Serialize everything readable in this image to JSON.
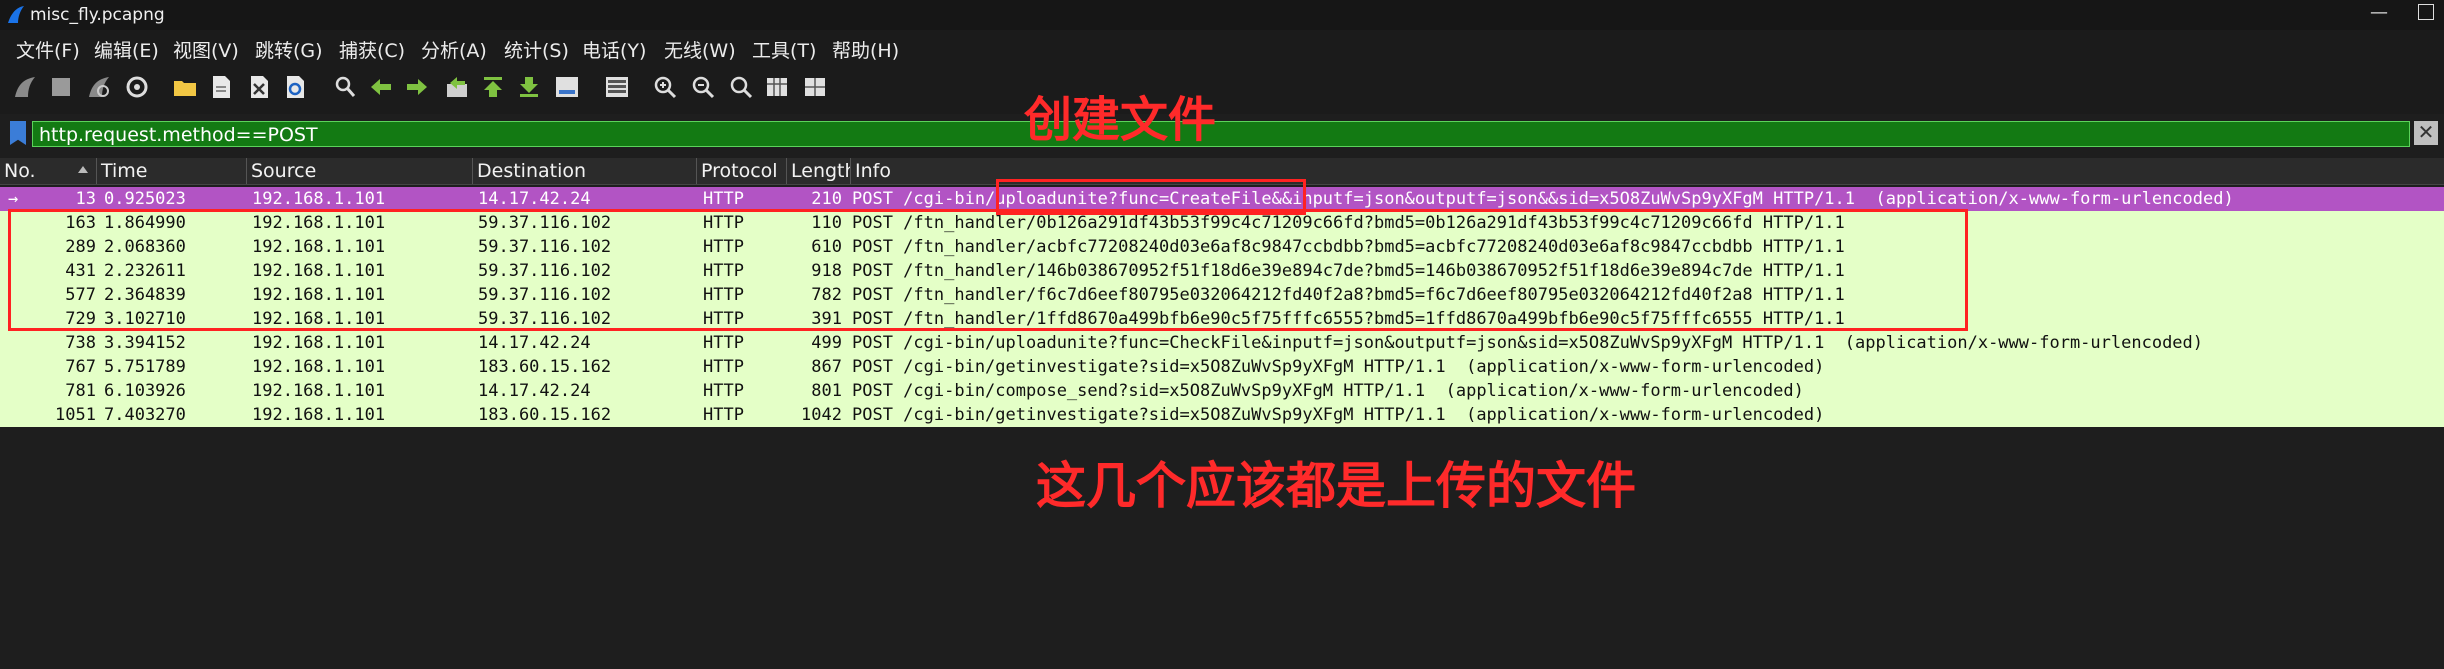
{
  "window": {
    "title": "misc_fly.pcapng",
    "minimize": "—"
  },
  "menu": [
    "文件(F)",
    "编辑(E)",
    "视图(V)",
    "跳转(G)",
    "捕获(C)",
    "分析(A)",
    "统计(S)",
    "电话(Y)",
    "无线(W)",
    "工具(T)",
    "帮助(H)"
  ],
  "filter": {
    "value": "http.request.method==POST",
    "clear": "✕"
  },
  "columns": [
    "No.",
    "Time",
    "Source",
    "Destination",
    "Protocol",
    "Length",
    "Info"
  ],
  "rows": [
    {
      "no": "13",
      "time": "0.925023",
      "src": "192.168.1.101",
      "dst": "14.17.42.24",
      "proto": "HTTP",
      "len": "210",
      "info": "POST /cgi-bin/uploadunite?func=CreateFile&&inputf=json&outputf=json&&sid=x5O8ZuWvSp9yXFgM HTTP/1.1  (application/x-www-form-urlencoded)"
    },
    {
      "no": "163",
      "time": "1.864990",
      "src": "192.168.1.101",
      "dst": "59.37.116.102",
      "proto": "HTTP",
      "len": "110",
      "info": "POST /ftn_handler/0b126a291df43b53f99c4c71209c66fd?bmd5=0b126a291df43b53f99c4c71209c66fd HTTP/1.1"
    },
    {
      "no": "289",
      "time": "2.068360",
      "src": "192.168.1.101",
      "dst": "59.37.116.102",
      "proto": "HTTP",
      "len": "610",
      "info": "POST /ftn_handler/acbfc77208240d03e6af8c9847ccbdbb?bmd5=acbfc77208240d03e6af8c9847ccbdbb HTTP/1.1"
    },
    {
      "no": "431",
      "time": "2.232611",
      "src": "192.168.1.101",
      "dst": "59.37.116.102",
      "proto": "HTTP",
      "len": "918",
      "info": "POST /ftn_handler/146b038670952f51f18d6e39e894c7de?bmd5=146b038670952f51f18d6e39e894c7de HTTP/1.1"
    },
    {
      "no": "577",
      "time": "2.364839",
      "src": "192.168.1.101",
      "dst": "59.37.116.102",
      "proto": "HTTP",
      "len": "782",
      "info": "POST /ftn_handler/f6c7d6eef80795e032064212fd40f2a8?bmd5=f6c7d6eef80795e032064212fd40f2a8 HTTP/1.1"
    },
    {
      "no": "729",
      "time": "3.102710",
      "src": "192.168.1.101",
      "dst": "59.37.116.102",
      "proto": "HTTP",
      "len": "391",
      "info": "POST /ftn_handler/1ffd8670a499bfb6e90c5f75fffc6555?bmd5=1ffd8670a499bfb6e90c5f75fffc6555 HTTP/1.1"
    },
    {
      "no": "738",
      "time": "3.394152",
      "src": "192.168.1.101",
      "dst": "14.17.42.24",
      "proto": "HTTP",
      "len": "499",
      "info": "POST /cgi-bin/uploadunite?func=CheckFile&inputf=json&outputf=json&sid=x5O8ZuWvSp9yXFgM HTTP/1.1  (application/x-www-form-urlencoded)"
    },
    {
      "no": "767",
      "time": "5.751789",
      "src": "192.168.1.101",
      "dst": "183.60.15.162",
      "proto": "HTTP",
      "len": "867",
      "info": "POST /cgi-bin/getinvestigate?sid=x5O8ZuWvSp9yXFgM HTTP/1.1  (application/x-www-form-urlencoded)"
    },
    {
      "no": "781",
      "time": "6.103926",
      "src": "192.168.1.101",
      "dst": "14.17.42.24",
      "proto": "HTTP",
      "len": "801",
      "info": "POST /cgi-bin/compose_send?sid=x5O8ZuWvSp9yXFgM HTTP/1.1  (application/x-www-form-urlencoded)"
    },
    {
      "no": "1051",
      "time": "7.403270",
      "src": "192.168.1.101",
      "dst": "183.60.15.162",
      "proto": "HTTP",
      "len": "1042",
      "info": "POST /cgi-bin/getinvestigate?sid=x5O8ZuWvSp9yXFgM HTTP/1.1  (application/x-www-form-urlencoded)"
    }
  ],
  "annotations": {
    "create_file": "创建文件",
    "uploaded_files": "这几个应该都是上传的文件"
  },
  "colors": {
    "http_row": "#e4ffc7",
    "selected_row": "#b254c4",
    "filter_ok": "#137a13",
    "annotation": "#ff2222"
  }
}
